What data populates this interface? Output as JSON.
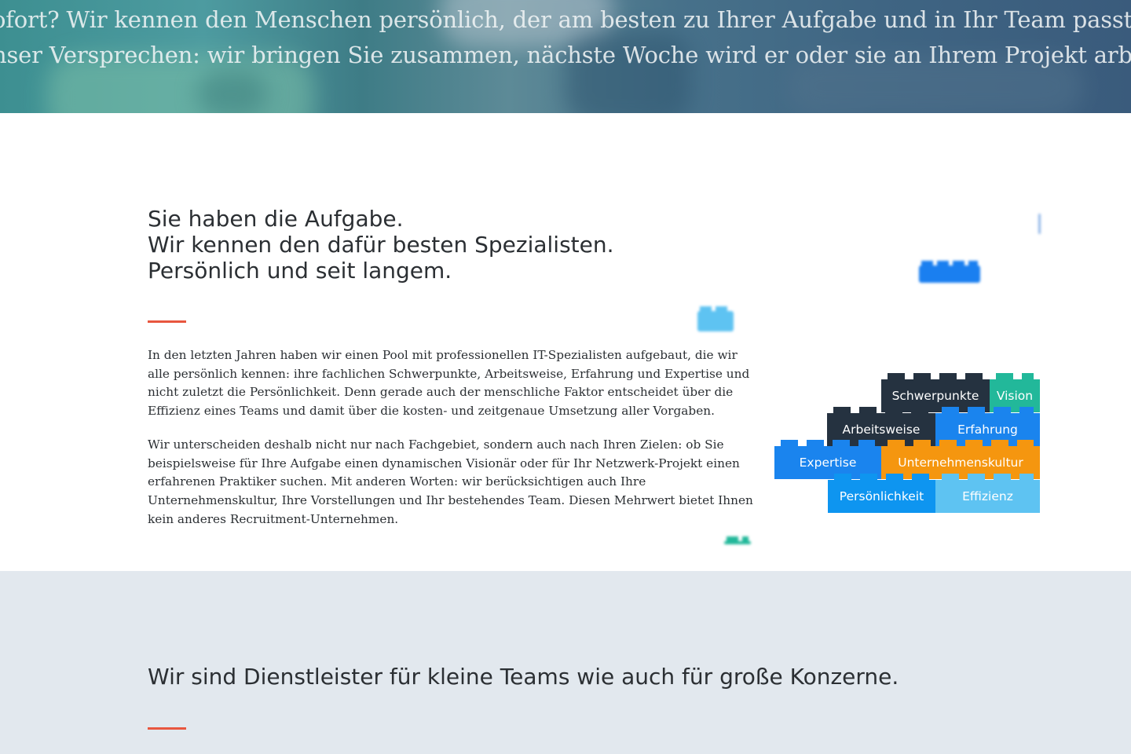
{
  "hero": {
    "line1": "ofort? Wir kennen den Menschen persönlich, der am besten zu Ihrer Aufgabe und in Ihr Team passt.",
    "line2": "nser Versprechen: wir bringen Sie zusammen, nächste Woche wird er oder sie an Ihrem Projekt arbe"
  },
  "intro": {
    "heading_lines": [
      "Sie haben die Aufgabe.",
      "Wir kennen den dafür besten Spezialisten.",
      "Persönlich und seit langem."
    ],
    "paragraph1_lines": [
      "In den letzten Jahren haben wir einen Pool mit professionellen IT-Spezialisten aufgebaut, die wir",
      "alle persönlich kennen: ihre fachlichen Schwerpunkte, Arbeitsweise, Erfahrung und Expertise und",
      "nicht zuletzt die Persönlichkeit. Denn gerade auch der menschliche Faktor entscheidet über die",
      "Effizienz eines Teams und damit über die kosten- und zeitgenaue Umsetzung aller Vorgaben."
    ],
    "paragraph2_lines": [
      "Wir unterscheiden deshalb nicht nur nach Fachgebiet, sondern auch nach Ihren Zielen: ob Sie",
      "beispielsweise für Ihre Aufgabe einen dynamischen Visionär oder für Ihr Netzwerk-Projekt einen",
      "erfahrenen Praktiker suchen. Mit anderen Worten: wir berücksichtigen auch Ihre",
      "Unternehmenskultur, Ihre Vorstellungen und Ihr bestehendes Team. Diesen Mehrwert bietet Ihnen",
      "kein anderes Recruitment-Unternehmen."
    ]
  },
  "lego": {
    "colors": {
      "dark": "#253240",
      "teal": "#22b89a",
      "blue": "#1a84ee",
      "orange": "#f5960f",
      "light_blue": "#5ec3f2",
      "mid_blue": "#0e95f0"
    },
    "bricks": {
      "schwerpunkte": "Schwerpunkte",
      "vision": "Vision",
      "arbeitsweise": "Arbeitsweise",
      "erfahrung": "Erfahrung",
      "expertise": "Expertise",
      "unternehmenskultur": "Unternehmenskultur",
      "persoenlichkeit": "Persönlichkeit",
      "effizienz": "Effizienz"
    }
  },
  "lower": {
    "heading": "Wir sind Dienstleister für kleine Teams wie auch für große Konzerne."
  },
  "accent_color": "#e8563f"
}
